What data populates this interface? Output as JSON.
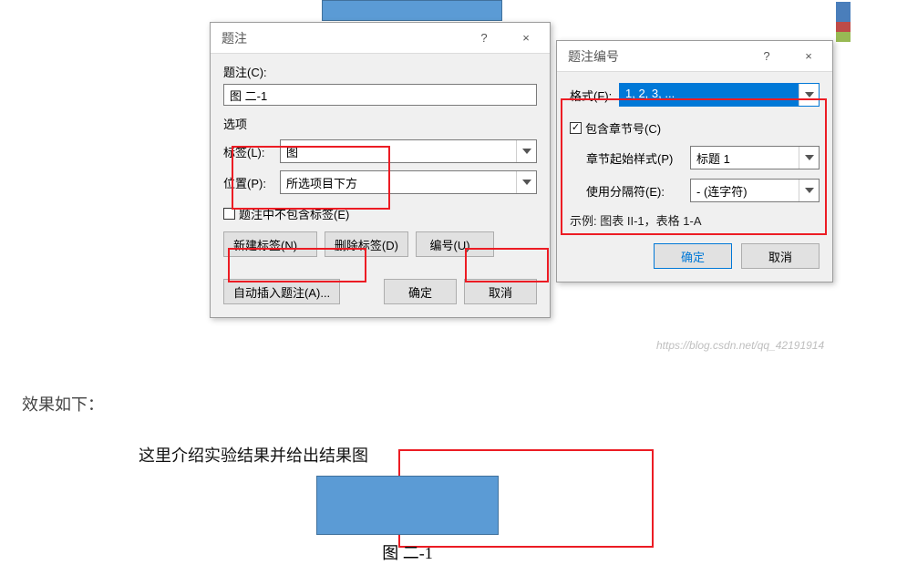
{
  "dialog1": {
    "title": "题注",
    "help": "?",
    "close": "×",
    "caption_label": "题注(C):",
    "caption_value": "图 二-1",
    "options_label": "选项",
    "label_lbl": "标签(L):",
    "label_value": "图",
    "position_lbl": "位置(P):",
    "position_value": "所选项目下方",
    "exclude_chk": "题注中不包含标签(E)",
    "new_label_btn": "新建标签(N)...",
    "del_label_btn": "删除标签(D)",
    "numbering_btn": "编号(U)...",
    "auto_btn": "自动插入题注(A)...",
    "ok_btn": "确定",
    "cancel_btn": "取消"
  },
  "dialog2": {
    "title": "题注编号",
    "help": "?",
    "close": "×",
    "format_lbl": "格式(F):",
    "format_value": "1, 2, 3, ...",
    "include_chk": "包含章节号(C)",
    "chapter_style_lbl": "章节起始样式(P)",
    "chapter_style_value": "标题 1",
    "separator_lbl": "使用分隔符(E):",
    "separator_value": "-    (连字符)",
    "example_lbl": "示例:",
    "example_value": "图表 II-1，表格 1-A",
    "ok_btn": "确定",
    "cancel_btn": "取消"
  },
  "lower": {
    "effect": "效果如下：",
    "desc": "这里介绍实验结果并给出结果图",
    "caption": "图 二-1"
  },
  "watermark": "https://blog.csdn.net/qq_42191914"
}
